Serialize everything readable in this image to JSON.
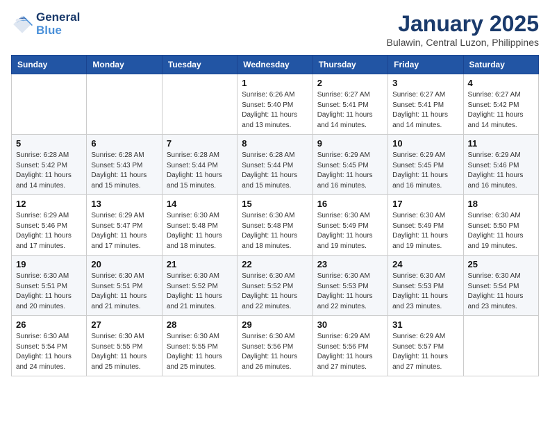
{
  "header": {
    "logo_line1": "General",
    "logo_line2": "Blue",
    "month_title": "January 2025",
    "location": "Bulawin, Central Luzon, Philippines"
  },
  "days_of_week": [
    "Sunday",
    "Monday",
    "Tuesday",
    "Wednesday",
    "Thursday",
    "Friday",
    "Saturday"
  ],
  "weeks": [
    [
      {
        "day": "",
        "info": ""
      },
      {
        "day": "",
        "info": ""
      },
      {
        "day": "",
        "info": ""
      },
      {
        "day": "1",
        "info": "Sunrise: 6:26 AM\nSunset: 5:40 PM\nDaylight: 11 hours\nand 13 minutes."
      },
      {
        "day": "2",
        "info": "Sunrise: 6:27 AM\nSunset: 5:41 PM\nDaylight: 11 hours\nand 14 minutes."
      },
      {
        "day": "3",
        "info": "Sunrise: 6:27 AM\nSunset: 5:41 PM\nDaylight: 11 hours\nand 14 minutes."
      },
      {
        "day": "4",
        "info": "Sunrise: 6:27 AM\nSunset: 5:42 PM\nDaylight: 11 hours\nand 14 minutes."
      }
    ],
    [
      {
        "day": "5",
        "info": "Sunrise: 6:28 AM\nSunset: 5:42 PM\nDaylight: 11 hours\nand 14 minutes."
      },
      {
        "day": "6",
        "info": "Sunrise: 6:28 AM\nSunset: 5:43 PM\nDaylight: 11 hours\nand 15 minutes."
      },
      {
        "day": "7",
        "info": "Sunrise: 6:28 AM\nSunset: 5:44 PM\nDaylight: 11 hours\nand 15 minutes."
      },
      {
        "day": "8",
        "info": "Sunrise: 6:28 AM\nSunset: 5:44 PM\nDaylight: 11 hours\nand 15 minutes."
      },
      {
        "day": "9",
        "info": "Sunrise: 6:29 AM\nSunset: 5:45 PM\nDaylight: 11 hours\nand 16 minutes."
      },
      {
        "day": "10",
        "info": "Sunrise: 6:29 AM\nSunset: 5:45 PM\nDaylight: 11 hours\nand 16 minutes."
      },
      {
        "day": "11",
        "info": "Sunrise: 6:29 AM\nSunset: 5:46 PM\nDaylight: 11 hours\nand 16 minutes."
      }
    ],
    [
      {
        "day": "12",
        "info": "Sunrise: 6:29 AM\nSunset: 5:46 PM\nDaylight: 11 hours\nand 17 minutes."
      },
      {
        "day": "13",
        "info": "Sunrise: 6:29 AM\nSunset: 5:47 PM\nDaylight: 11 hours\nand 17 minutes."
      },
      {
        "day": "14",
        "info": "Sunrise: 6:30 AM\nSunset: 5:48 PM\nDaylight: 11 hours\nand 18 minutes."
      },
      {
        "day": "15",
        "info": "Sunrise: 6:30 AM\nSunset: 5:48 PM\nDaylight: 11 hours\nand 18 minutes."
      },
      {
        "day": "16",
        "info": "Sunrise: 6:30 AM\nSunset: 5:49 PM\nDaylight: 11 hours\nand 19 minutes."
      },
      {
        "day": "17",
        "info": "Sunrise: 6:30 AM\nSunset: 5:49 PM\nDaylight: 11 hours\nand 19 minutes."
      },
      {
        "day": "18",
        "info": "Sunrise: 6:30 AM\nSunset: 5:50 PM\nDaylight: 11 hours\nand 19 minutes."
      }
    ],
    [
      {
        "day": "19",
        "info": "Sunrise: 6:30 AM\nSunset: 5:51 PM\nDaylight: 11 hours\nand 20 minutes."
      },
      {
        "day": "20",
        "info": "Sunrise: 6:30 AM\nSunset: 5:51 PM\nDaylight: 11 hours\nand 21 minutes."
      },
      {
        "day": "21",
        "info": "Sunrise: 6:30 AM\nSunset: 5:52 PM\nDaylight: 11 hours\nand 21 minutes."
      },
      {
        "day": "22",
        "info": "Sunrise: 6:30 AM\nSunset: 5:52 PM\nDaylight: 11 hours\nand 22 minutes."
      },
      {
        "day": "23",
        "info": "Sunrise: 6:30 AM\nSunset: 5:53 PM\nDaylight: 11 hours\nand 22 minutes."
      },
      {
        "day": "24",
        "info": "Sunrise: 6:30 AM\nSunset: 5:53 PM\nDaylight: 11 hours\nand 23 minutes."
      },
      {
        "day": "25",
        "info": "Sunrise: 6:30 AM\nSunset: 5:54 PM\nDaylight: 11 hours\nand 23 minutes."
      }
    ],
    [
      {
        "day": "26",
        "info": "Sunrise: 6:30 AM\nSunset: 5:54 PM\nDaylight: 11 hours\nand 24 minutes."
      },
      {
        "day": "27",
        "info": "Sunrise: 6:30 AM\nSunset: 5:55 PM\nDaylight: 11 hours\nand 25 minutes."
      },
      {
        "day": "28",
        "info": "Sunrise: 6:30 AM\nSunset: 5:55 PM\nDaylight: 11 hours\nand 25 minutes."
      },
      {
        "day": "29",
        "info": "Sunrise: 6:30 AM\nSunset: 5:56 PM\nDaylight: 11 hours\nand 26 minutes."
      },
      {
        "day": "30",
        "info": "Sunrise: 6:29 AM\nSunset: 5:56 PM\nDaylight: 11 hours\nand 27 minutes."
      },
      {
        "day": "31",
        "info": "Sunrise: 6:29 AM\nSunset: 5:57 PM\nDaylight: 11 hours\nand 27 minutes."
      },
      {
        "day": "",
        "info": ""
      }
    ]
  ]
}
